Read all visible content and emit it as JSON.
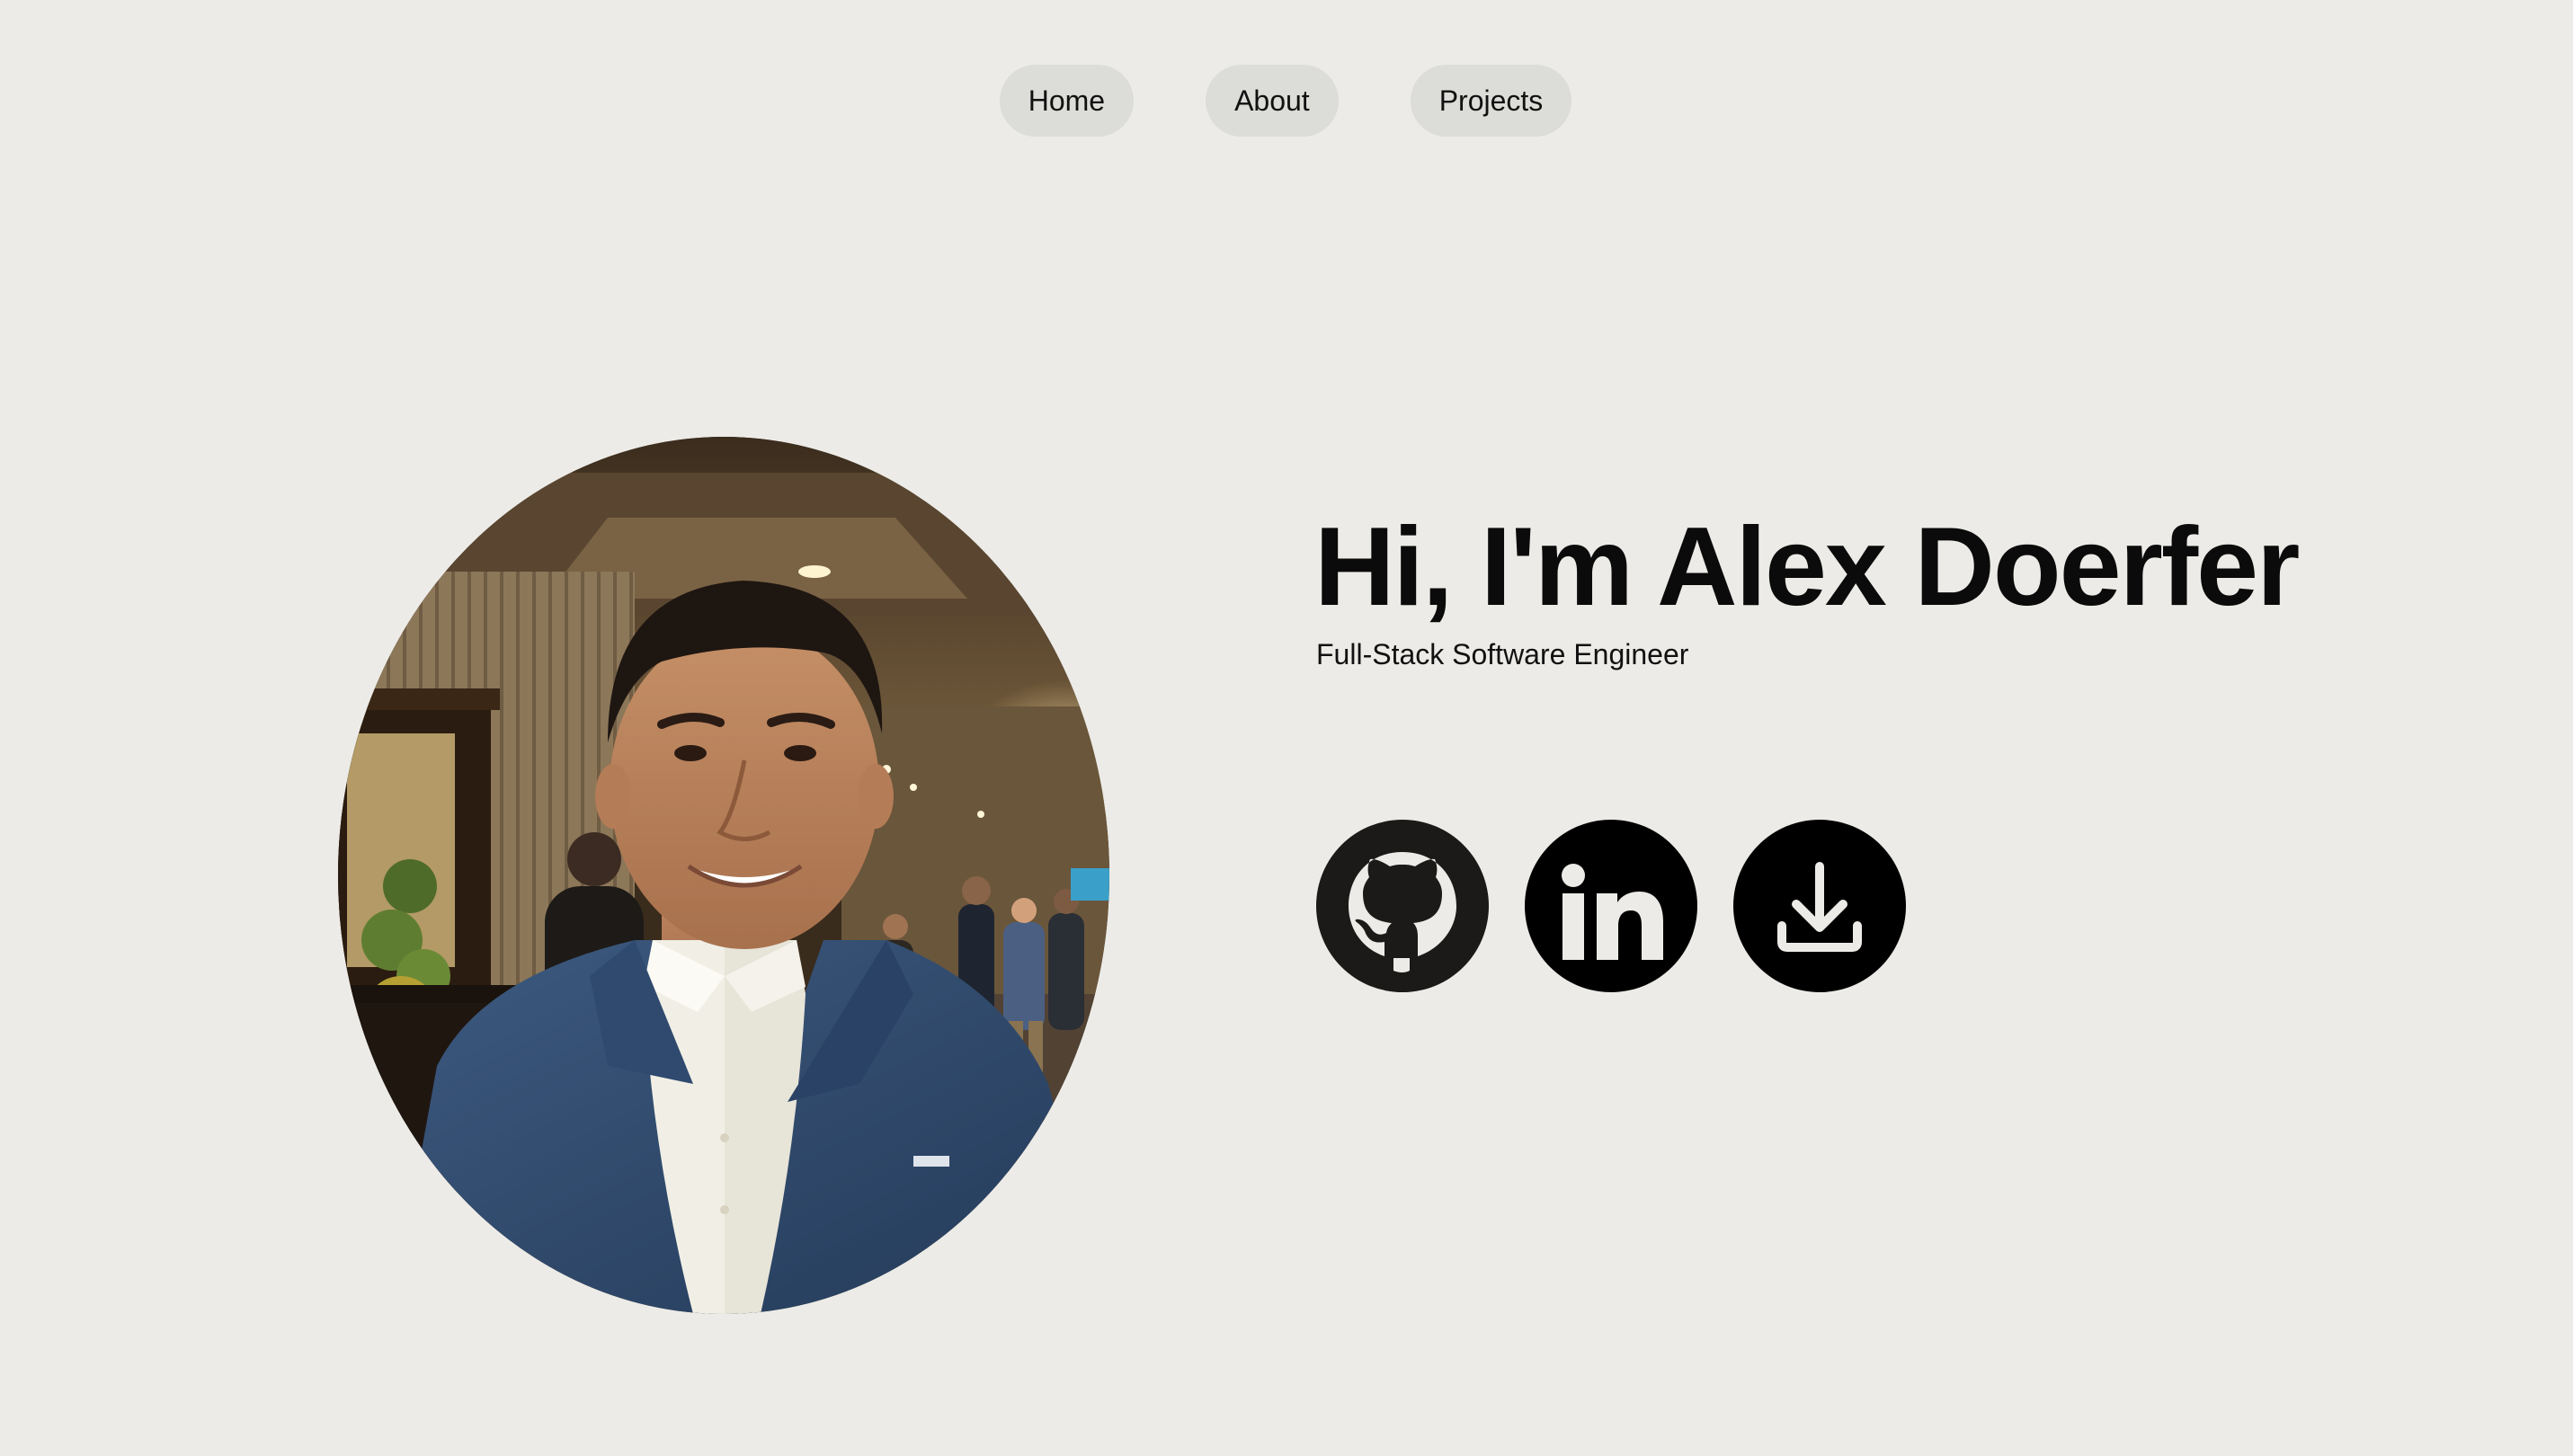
{
  "nav": {
    "items": [
      {
        "label": "Home"
      },
      {
        "label": "About"
      },
      {
        "label": "Projects"
      }
    ]
  },
  "hero": {
    "title": "Hi, I'm Alex Doerfer",
    "subtitle": "Full-Stack Software Engineer"
  },
  "portrait": {
    "description_icon": "profile-photo"
  },
  "social": {
    "items": [
      {
        "icon": "github-icon"
      },
      {
        "icon": "linkedin-icon"
      },
      {
        "icon": "download-icon"
      }
    ]
  },
  "colors": {
    "background": "#ecebe7",
    "nav_pill": "#dcdcd8",
    "text": "#0b0b0b",
    "icon_bg": "#000000"
  }
}
